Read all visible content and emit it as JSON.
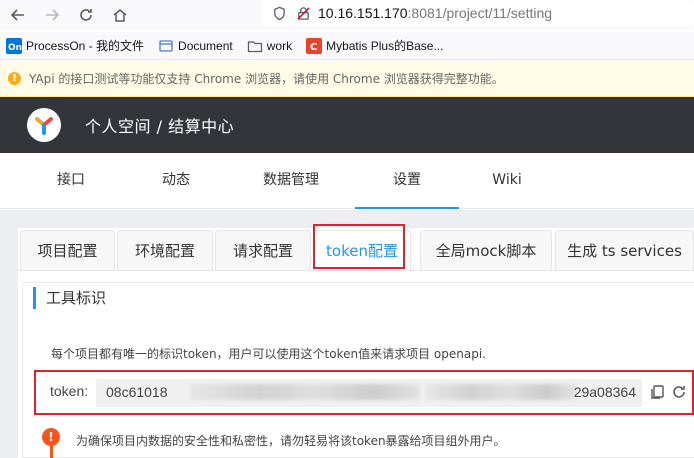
{
  "browser": {
    "url_host": "10.16.151.170",
    "url_rest": ":8081/project/11/setting"
  },
  "bookmarks": [
    {
      "label": "ProcessOn - 我的文件",
      "icon": "processon-icon"
    },
    {
      "label": "Document",
      "icon": "document-icon"
    },
    {
      "label": "work",
      "icon": "folder-icon"
    },
    {
      "label": "Mybatis Plus的Base...",
      "icon": "mybatis-icon"
    }
  ],
  "warning": {
    "text": "YApi 的接口测试等功能仅支持 Chrome 浏览器，请使用 Chrome 浏览器获得完整功能。"
  },
  "header": {
    "breadcrumb": "个人空间 / 结算中心"
  },
  "nav": {
    "items": [
      "接口",
      "动态",
      "数据管理",
      "设置",
      "Wiki"
    ],
    "active": "设置"
  },
  "tabs": {
    "items": [
      "项目配置",
      "环境配置",
      "请求配置",
      "token配置",
      "全局mock脚本",
      "生成 ts services"
    ],
    "active": "token配置"
  },
  "token_section": {
    "title": "工具标识",
    "description": "每个项目都有唯一的标识token，用户可以使用这个token值来请求项目 openapi.",
    "label": "token:",
    "token_start": "08c61018",
    "token_end": "29a08364",
    "note": "为确保项目内数据的安全性和私密性，请勿轻易将该token暴露给项目组外用户。"
  },
  "colors": {
    "accent": "#2395f1",
    "header_bg": "#32363a",
    "highlight": "#d9262c",
    "warning_bg": "#fffbe6",
    "note_icon": "#fa541c"
  }
}
